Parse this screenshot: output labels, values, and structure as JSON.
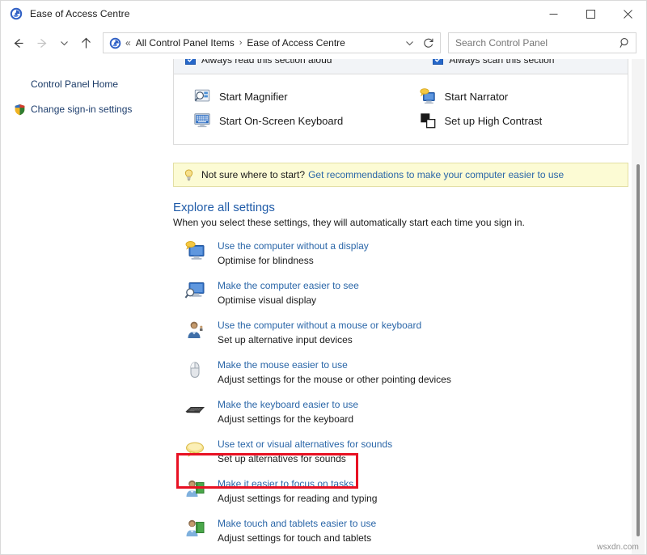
{
  "window": {
    "title": "Ease of Access Centre",
    "app_icon": "ease-of-access-icon",
    "minimize_label": "Minimise",
    "maximize_label": "Maximise",
    "close_label": "Close"
  },
  "nav": {
    "back_label": "Back",
    "forward_label": "Forward",
    "recent_label": "Recent locations",
    "up_label": "Up",
    "refresh_label": "Refresh",
    "breadcrumb_overflow": "«",
    "breadcrumb": [
      "All Control Panel Items",
      "Ease of Access Centre"
    ],
    "breadcrumb_separator": "›",
    "dropdown_label": "Previous locations"
  },
  "search": {
    "placeholder": "Search Control Panel",
    "value": ""
  },
  "sidebar": {
    "items": [
      {
        "label": "Control Panel Home",
        "icon": "none"
      },
      {
        "label": "Change sign-in settings",
        "icon": "shield-icon"
      }
    ]
  },
  "quick_panel": {
    "checkboxes": [
      {
        "label": "Always read this section aloud",
        "checked": true
      },
      {
        "label": "Always scan this section",
        "checked": true
      }
    ],
    "actions": [
      {
        "label": "Start Magnifier",
        "icon": "magnifier-icon"
      },
      {
        "label": "Start On-Screen Keyboard",
        "icon": "osk-icon"
      },
      {
        "label": "Start Narrator",
        "icon": "narrator-icon"
      },
      {
        "label": "Set up High Contrast",
        "icon": "high-contrast-icon"
      }
    ]
  },
  "tip": {
    "icon": "lightbulb-icon",
    "text": "Not sure where to start?",
    "link": "Get recommendations to make your computer easier to use"
  },
  "explore": {
    "title": "Explore all settings",
    "subtitle": "When you select these settings, they will automatically start each time you sign in.",
    "settings": [
      {
        "link": "Use the computer without a display",
        "desc": "Optimise for blindness",
        "icon": "display-off-icon",
        "highlighted": false
      },
      {
        "link": "Make the computer easier to see",
        "desc": "Optimise visual display",
        "icon": "monitor-magnify-icon",
        "highlighted": false
      },
      {
        "link": "Use the computer without a mouse or keyboard",
        "desc": "Set up alternative input devices",
        "icon": "person-input-icon",
        "highlighted": false
      },
      {
        "link": "Make the mouse easier to use",
        "desc": "Adjust settings for the mouse or other pointing devices",
        "icon": "mouse-icon",
        "highlighted": false
      },
      {
        "link": "Make the keyboard easier to use",
        "desc": "Adjust settings for the keyboard",
        "icon": "keyboard-icon",
        "highlighted": true
      },
      {
        "link": "Use text or visual alternatives for sounds",
        "desc": "Set up alternatives for sounds",
        "icon": "speech-bubble-icon",
        "highlighted": false
      },
      {
        "link": "Make it easier to focus on tasks",
        "desc": "Adjust settings for reading and typing",
        "icon": "person-board-icon",
        "highlighted": false
      },
      {
        "link": "Make touch and tablets easier to use",
        "desc": "Adjust settings for touch and tablets",
        "icon": "person-board-icon",
        "highlighted": false
      }
    ]
  },
  "annotation": {
    "highlight_color": "#e81123",
    "highlight_target": "Make the keyboard easier to use"
  },
  "scrollbar": {
    "orientation": "vertical",
    "thumb_position_percent": 21
  },
  "watermark": "wsxdn.com"
}
